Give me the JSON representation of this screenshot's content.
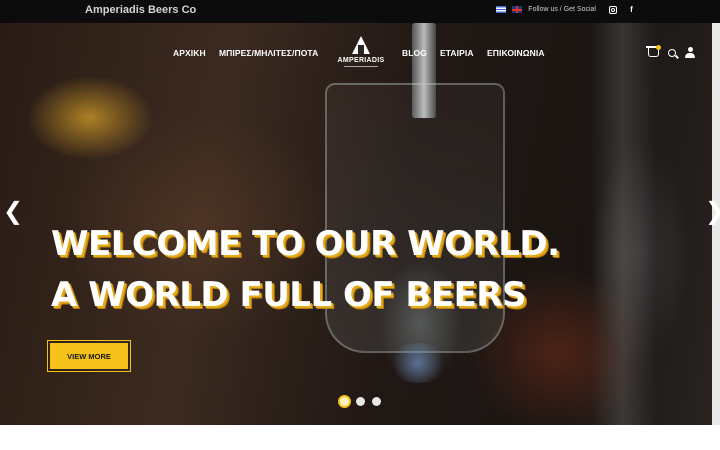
{
  "topbar": {
    "brand": "Amperiadis Beers Co",
    "follow_text": "Follow us / Get Social",
    "languages": [
      "greek-flag",
      "english-flag"
    ],
    "socials": [
      "instagram-icon",
      "facebook-icon"
    ]
  },
  "nav": {
    "items": [
      "ΑΡΧΙΚΗ",
      "ΜΠΙΡΕΣ/ΜΗΛΙΤΕΣ/ΠΟΤΑ",
      "BLOG",
      "ΕΤΑΙΡΙΑ",
      "ΕΠΙΚΟΙΝΩΝΙΑ"
    ],
    "logo_text": "AMPERIADIS",
    "icons": [
      "cart-icon",
      "search-icon",
      "user-icon"
    ]
  },
  "hero": {
    "headline_line1": "WELCOME TO OUR WORLD.",
    "headline_line2": "A WORLD FULL OF BEERS",
    "cta_label": "VIEW MORE",
    "prev_arrow": "❮",
    "next_arrow": "❯",
    "slides_count": 3,
    "active_slide": 1
  },
  "colors": {
    "accent": "#f5c21b",
    "topbar_bg": "#0c0c0c"
  }
}
